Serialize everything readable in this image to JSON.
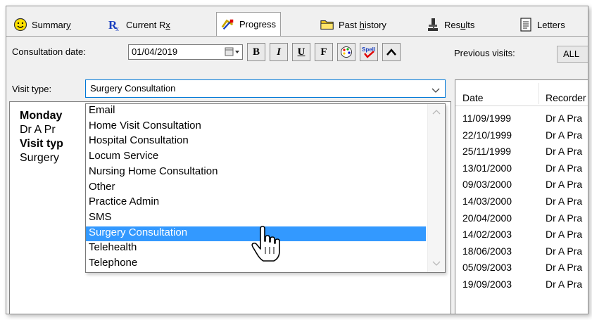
{
  "tabs": [
    {
      "label": "Summary",
      "mnemonic": "y",
      "icon": "smiley-icon"
    },
    {
      "label": "Current Rx",
      "mnemonic": "x",
      "icon": "rx-icon"
    },
    {
      "label": "Progress",
      "mnemonic": "",
      "icon": "progress-icon",
      "active": true
    },
    {
      "label": "Past history",
      "mnemonic": "h",
      "icon": "folder-icon"
    },
    {
      "label": "Results",
      "mnemonic": "u",
      "icon": "microscope-icon"
    },
    {
      "label": "Letters",
      "mnemonic": "",
      "icon": "letter-icon"
    }
  ],
  "consultation": {
    "date_label": "Consultation date:",
    "date_value": "01/04/2019",
    "previous_label": "Previous visits:",
    "previous_value": "ALL"
  },
  "format_buttons": [
    "B",
    "I",
    "U",
    "F"
  ],
  "visit_type": {
    "label": "Visit type:",
    "value": "Surgery Consultation",
    "options": [
      "Email",
      "Home Visit Consultation",
      "Hospital Consultation",
      "Locum Service",
      "Nursing Home Consultation",
      "Other",
      "Practice Admin",
      "SMS",
      "Surgery Consultation",
      "Telehealth",
      "Telephone"
    ],
    "selected_index": 8
  },
  "notes": {
    "line1": "Monday",
    "line2": "Dr A Pr",
    "line3": "Visit typ",
    "line4": "Surgery"
  },
  "visits_table": {
    "headers": [
      "Date",
      "Recorder"
    ],
    "rows": [
      [
        "11/09/1999",
        "Dr A Pra"
      ],
      [
        "22/10/1999",
        "Dr A Pra"
      ],
      [
        "25/11/1999",
        "Dr A Pra"
      ],
      [
        "13/01/2000",
        "Dr A Pra"
      ],
      [
        "09/03/2000",
        "Dr A Pra"
      ],
      [
        "14/03/2000",
        "Dr A Pra"
      ],
      [
        "20/04/2000",
        "Dr A Pra"
      ],
      [
        "14/02/2003",
        "Dr A Pra"
      ],
      [
        "18/06/2003",
        "Dr A Pra"
      ],
      [
        "05/09/2003",
        "Dr A Pra"
      ],
      [
        "19/09/2003",
        "Dr A Pra"
      ]
    ]
  },
  "colors": {
    "selection": "#3399ff",
    "focus_border": "#0078d7",
    "window_bg": "#f0f0f0"
  }
}
